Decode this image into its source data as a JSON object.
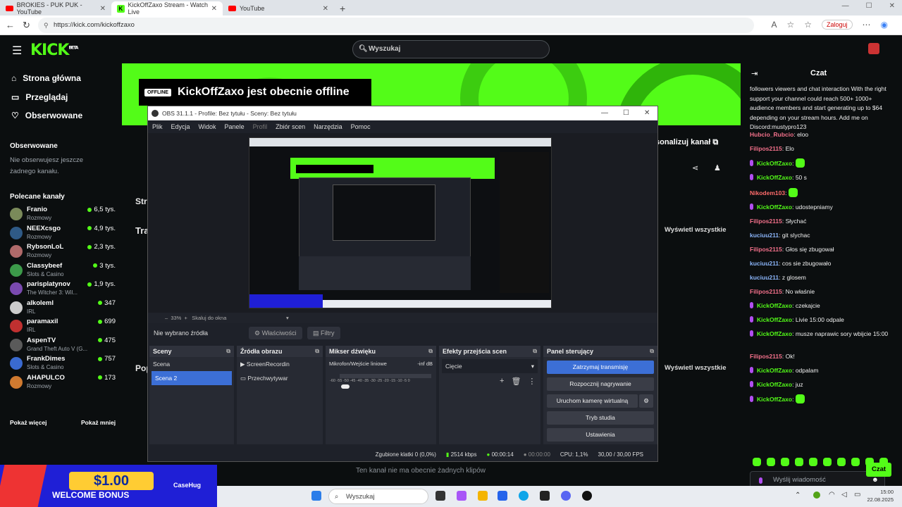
{
  "browser": {
    "tabs": [
      {
        "title": "BROKIES - PUK PUK - YouTube",
        "icon": "youtube-icon"
      },
      {
        "title": "KickOffZaxo Stream - Watch Live",
        "icon": "kick-icon"
      },
      {
        "title": "YouTube",
        "icon": "youtube-icon"
      }
    ],
    "url": "https://kick.com/kickoffzaxo",
    "login_label": "Zaloguj"
  },
  "kick": {
    "logo": "KICK",
    "logo_sup": "BETA",
    "search_placeholder": "Wyszukaj",
    "nav": [
      "Strona główna",
      "Przeglądaj",
      "Obserwowane"
    ],
    "followed_title": "Obserwowane",
    "followed_empty": [
      "Nie obserwujesz jeszcze",
      "żadnego kanału."
    ],
    "recommended_title": "Polecane kanały",
    "channels": [
      {
        "name": "Franio",
        "category": "Rozmowy",
        "viewers": "6,5 tys.",
        "color": "#7a8a5a"
      },
      {
        "name": "NEEXcsgo",
        "category": "Rozmowy",
        "viewers": "4,9 tys.",
        "color": "#2f5a86"
      },
      {
        "name": "RybsonLoL",
        "category": "Rozmowy",
        "viewers": "2,3 tys.",
        "color": "#b06a6a"
      },
      {
        "name": "Classybeef",
        "category": "Slots & Casino",
        "viewers": "3 tys.",
        "color": "#3c9a4a"
      },
      {
        "name": "parisplatynov",
        "category": "The Witcher 3: Wil...",
        "viewers": "1,9 tys.",
        "color": "#7a4ab0"
      },
      {
        "name": "alkoleml",
        "category": "IRL",
        "viewers": "347",
        "color": "#cccccc"
      },
      {
        "name": "paramaxil",
        "category": "IRL",
        "viewers": "699",
        "color": "#c03030"
      },
      {
        "name": "AspenTV",
        "category": "Grand Theft Auto V (G...",
        "viewers": "475",
        "color": "#5a5a5a"
      },
      {
        "name": "FrankDimes",
        "category": "Slots & Casino",
        "viewers": "757",
        "color": "#3a6ad0"
      },
      {
        "name": "AHAPULCO",
        "category": "Rozmowy",
        "viewers": "173",
        "color": "#d07a30"
      }
    ],
    "show_more": "Pokaż więcej",
    "show_less": "Pokaż mniej",
    "offline_badge": "OFFLINE",
    "offline_title": "KickOffZaxo jest obecnie offline",
    "personalize": "sonalizuj kanał",
    "show_all": "Wyświetl wszystkie",
    "side_labels": [
      "Stro",
      "Tra",
      "Pop"
    ],
    "no_clips": "Ten kanał nie ma obecnie żadnych klipów"
  },
  "chat": {
    "title": "Czat",
    "messages": [
      {
        "user": "",
        "text": "followers viewers and chat interaction With the right support your channel could reach 500+ 1000+ audience members and start generating up to $64 depending on your stream hours. Add me on Discord:mustypro123",
        "color": "pink",
        "mic": false
      },
      {
        "user": "Hubcio_Rubcio",
        "text": "eloo",
        "color": "pink",
        "mic": false
      },
      {
        "user": "Filipos2115",
        "text": "Elo",
        "color": "pink",
        "mic": false
      },
      {
        "user": "KickOffZaxo",
        "text": "",
        "color": "green",
        "mic": true,
        "emote": true
      },
      {
        "user": "KickOffZaxo",
        "text": "50 s",
        "color": "green",
        "mic": true
      },
      {
        "user": "Nikodem103",
        "text": "",
        "color": "red",
        "mic": false,
        "emote": true
      },
      {
        "user": "KickOffZaxo",
        "text": "udostepniamy",
        "color": "green",
        "mic": true
      },
      {
        "user": "Filipos2115",
        "text": "Słychać",
        "color": "pink",
        "mic": false
      },
      {
        "user": "kuciuu211",
        "text": "git slychac",
        "color": "blue",
        "mic": false
      },
      {
        "user": "Filipos2115",
        "text": "Głos się zbugował",
        "color": "pink",
        "mic": false
      },
      {
        "user": "kuciuu211",
        "text": "cos sie zbugowało",
        "color": "blue",
        "mic": false
      },
      {
        "user": "kuciuu211",
        "text": "z glosem",
        "color": "blue",
        "mic": false
      },
      {
        "user": "Filipos2115",
        "text": "No właśnie",
        "color": "pink",
        "mic": false
      },
      {
        "user": "KickOffZaxo",
        "text": "czekajcie",
        "color": "green",
        "mic": true
      },
      {
        "user": "KickOffZaxo",
        "text": "Livie 15:00 odpale",
        "color": "green",
        "mic": true
      },
      {
        "user": "KickOffZaxo",
        "text": "musze naprawic sory wbijcie 15:00",
        "color": "green",
        "mic": true
      },
      {
        "user": "Filipos2115",
        "text": "Ok!",
        "color": "pink",
        "mic": false
      },
      {
        "user": "KickOffZaxo",
        "text": "odpalam",
        "color": "green",
        "mic": true
      },
      {
        "user": "KickOffZaxo",
        "text": "juz",
        "color": "green",
        "mic": true
      },
      {
        "user": "KickOffZaxo",
        "text": "",
        "color": "green",
        "mic": true,
        "emote": true
      }
    ],
    "input_placeholder": "Wyślij wiadomość",
    "send_label": "Czat"
  },
  "obs": {
    "title": "OBS 31.1.1 - Profile: Bez tytułu - Sceny: Bez tytułu",
    "menu": [
      "Plik",
      "Edycja",
      "Widok",
      "Panele",
      "Profil",
      "Zbiór scen",
      "Narzędzia",
      "Pomoc"
    ],
    "zoom": "33%",
    "scale_label": "Skaluj do okna",
    "no_source": "Nie wybrano źródła",
    "properties": "Właściwości",
    "filters": "Filtry",
    "docks": {
      "scenes": {
        "title": "Sceny",
        "items": [
          "Scena",
          "Scena 2"
        ]
      },
      "sources": {
        "title": "Źródła obrazu",
        "items": [
          "ScreenRecordin",
          "Przechwytywar"
        ]
      },
      "mixer": {
        "title": "Mikser dźwięku",
        "channel": "Mikrofon/Wejście liniowe",
        "level": "-inf dB",
        "ticks": "-60 -55 -50 -45 -40 -35 -30 -25 -20 -15 -10 -5 0"
      },
      "transitions": {
        "title": "Efekty przejścia scen",
        "selected": "Cięcie"
      },
      "controls": {
        "title": "Panel sterujący",
        "buttons": [
          "Zatrzymaj transmisję",
          "Rozpocznij nagrywanie",
          "Uruchom kamerę wirtualną",
          "Tryb studia",
          "Ustawienia"
        ]
      }
    },
    "status": {
      "dropped": "Zgubione klatki 0 (0,0%)",
      "kbps": "2514 kbps",
      "live_time": "00:00:14",
      "rec_time": "00:00:00",
      "cpu": "CPU: 1,1%",
      "fps": "30,00 / 30,00 FPS"
    }
  },
  "promo": {
    "amount": "$1.00",
    "text": "WELCOME BONUS",
    "brand": "CaseHug"
  },
  "taskbar": {
    "search": "Wyszukaj",
    "time": "15:00",
    "date": "22.08.2025"
  }
}
